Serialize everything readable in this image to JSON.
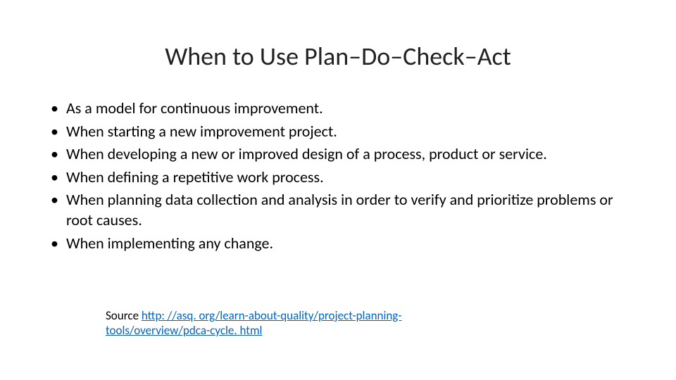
{
  "title": "When to Use Plan–Do–Check–Act",
  "bullets": [
    "As a model for continuous improvement.",
    "When starting a new improvement project.",
    "When developing a new or improved design of a process, product or service.",
    "When defining a repetitive work process.",
    "When planning data collection and analysis in order to verify and prioritize problems or root causes.",
    "When implementing any change."
  ],
  "source": {
    "label": "Source ",
    "link_text": "http: //asq. org/learn-about-quality/project-planning-tools/overview/pdca-cycle. html"
  }
}
